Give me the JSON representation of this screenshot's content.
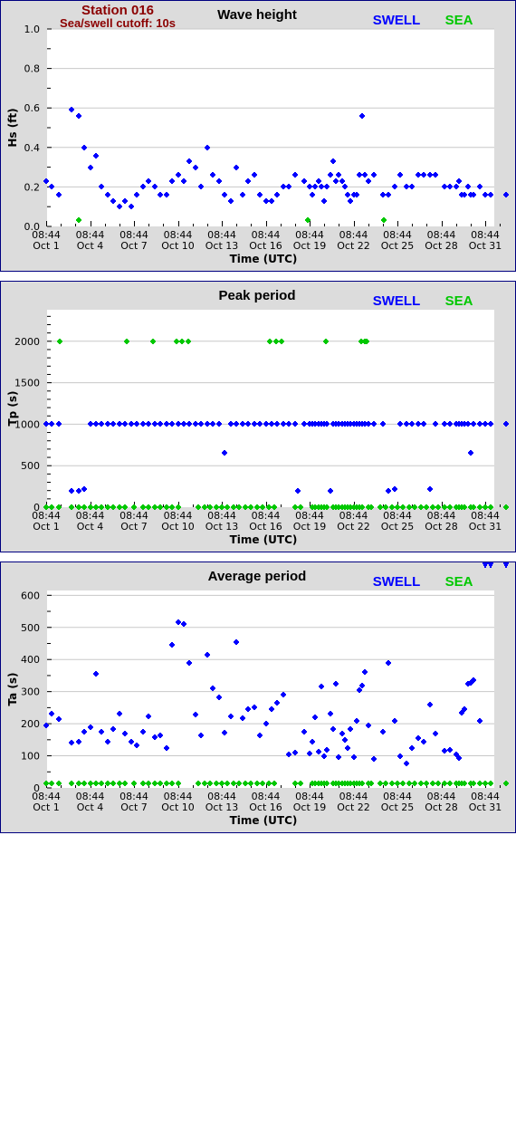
{
  "header": {
    "station": "Station 016",
    "cutoff": "Sea/swell cutoff: 10s"
  },
  "legend": {
    "swell_label": "SWELL",
    "sea_label": "SEA",
    "swell_color": "#0000ff",
    "sea_color": "#00c800"
  },
  "x_axis": {
    "label": "Time (UTC)",
    "ticks": [
      {
        "day": 0,
        "time": "08:44",
        "date": "Oct 1"
      },
      {
        "day": 3,
        "time": "08:44",
        "date": "Oct 4"
      },
      {
        "day": 6,
        "time": "08:44",
        "date": "Oct 7"
      },
      {
        "day": 9,
        "time": "08:44",
        "date": "Oct 10"
      },
      {
        "day": 12,
        "time": "08:44",
        "date": "Oct 13"
      },
      {
        "day": 15,
        "time": "08:44",
        "date": "Oct 16"
      },
      {
        "day": 18,
        "time": "08:44",
        "date": "Oct 19"
      },
      {
        "day": 21,
        "time": "08:44",
        "date": "Oct 22"
      },
      {
        "day": 24,
        "time": "08:44",
        "date": "Oct 25"
      },
      {
        "day": 27,
        "time": "08:44",
        "date": "Oct 28"
      },
      {
        "day": 30,
        "time": "08:44",
        "date": "Oct 31"
      }
    ],
    "range_days": [
      0,
      31.6
    ]
  },
  "chart_data": [
    {
      "type": "scatter",
      "title": "Wave height",
      "xlabel": "Time (UTC)",
      "ylabel": "Hs (ft)",
      "ylim": [
        0,
        1.0
      ],
      "yticks": [
        0.0,
        0.2,
        0.4,
        0.6,
        0.8,
        1.0
      ],
      "ytick_labels": [
        "0.0",
        "0.2",
        "0.4",
        "0.6",
        "0.8",
        "1.0"
      ],
      "yminor": [
        0.1,
        0.3,
        0.5,
        0.7,
        0.9
      ],
      "grid": true,
      "series": [
        {
          "name": "SWELL",
          "x": [
            0,
            0.4,
            0.85,
            1.75,
            2.2,
            2.6,
            3.0,
            3.4,
            3.8,
            4.2,
            4.6,
            5.0,
            5.4,
            5.8,
            6.2,
            6.6,
            7.0,
            7.4,
            7.8,
            8.2,
            8.6,
            9.0,
            9.4,
            9.8,
            10.2,
            10.6,
            11.0,
            11.4,
            11.8,
            12.2,
            12.6,
            13.0,
            13.4,
            13.8,
            14.2,
            14.6,
            15.0,
            15.4,
            15.8,
            16.2,
            16.6,
            17.0,
            17.6,
            18.0,
            18.2,
            18.4,
            18.6,
            18.8,
            19.0,
            19.2,
            19.4,
            19.6,
            19.8,
            20.0,
            20.2,
            20.4,
            20.6,
            20.8,
            21.0,
            21.2,
            21.4,
            21.6,
            21.8,
            22.0,
            22.4,
            23.0,
            23.4,
            23.8,
            24.2,
            24.6,
            25.0,
            25.4,
            25.8,
            26.2,
            26.6,
            27.2,
            27.6,
            28.0,
            28.2,
            28.4,
            28.6,
            28.8,
            29.0,
            29.2,
            29.6,
            30.0,
            30.4,
            31.4
          ],
          "y": [
            0.23,
            0.2,
            0.16,
            0.59,
            0.56,
            0.4,
            0.3,
            0.36,
            0.2,
            0.16,
            0.13,
            0.1,
            0.13,
            0.1,
            0.16,
            0.2,
            0.23,
            0.2,
            0.16,
            0.16,
            0.23,
            0.26,
            0.23,
            0.33,
            0.3,
            0.2,
            0.4,
            0.26,
            0.23,
            0.16,
            0.13,
            0.3,
            0.16,
            0.23,
            0.26,
            0.16,
            0.13,
            0.13,
            0.16,
            0.2,
            0.2,
            0.26,
            0.23,
            0.2,
            0.16,
            0.2,
            0.23,
            0.2,
            0.13,
            0.2,
            0.26,
            0.33,
            0.23,
            0.26,
            0.23,
            0.2,
            0.16,
            0.13,
            0.16,
            0.16,
            0.26,
            0.56,
            0.26,
            0.23,
            0.26,
            0.16,
            0.16,
            0.2,
            0.26,
            0.2,
            0.2,
            0.26,
            0.26,
            0.26,
            0.26,
            0.2,
            0.2,
            0.2,
            0.23,
            0.16,
            0.16,
            0.2,
            0.16,
            0.16,
            0.2,
            0.16,
            0.16,
            0.16
          ]
        },
        {
          "name": "SEA",
          "x": [
            2.2,
            17.9,
            23.1
          ],
          "y": [
            0.03,
            0.03,
            0.03
          ]
        }
      ]
    },
    {
      "type": "scatter",
      "title": "Peak period",
      "xlabel": "Time (UTC)",
      "ylabel": "Tp (s)",
      "ylim": [
        0,
        2380
      ],
      "yticks": [
        0,
        500,
        1000,
        1500,
        2000
      ],
      "ytick_labels": [
        "0",
        "500",
        "1000",
        "1500",
        "2000"
      ],
      "yminor": [
        100,
        200,
        300,
        400,
        600,
        700,
        800,
        900,
        1100,
        1200,
        1300,
        1400,
        1600,
        1700,
        1800,
        1900,
        2100,
        2200,
        2300
      ],
      "grid": true,
      "series": [
        {
          "name": "SWELL",
          "x": [
            0,
            0.4,
            0.85,
            1.75,
            2.2,
            2.6,
            3.0,
            3.4,
            3.8,
            4.2,
            4.6,
            5.0,
            5.4,
            5.8,
            6.2,
            6.6,
            7.0,
            7.4,
            7.8,
            8.2,
            8.6,
            9.0,
            9.4,
            9.8,
            10.2,
            10.6,
            11.0,
            11.4,
            11.8,
            12.2,
            12.6,
            13.0,
            13.4,
            13.8,
            14.2,
            14.6,
            15.0,
            15.4,
            15.8,
            16.2,
            16.6,
            17.0,
            17.2,
            17.6,
            18.0,
            18.2,
            18.4,
            18.6,
            18.8,
            19.0,
            19.2,
            19.4,
            19.6,
            19.8,
            20.0,
            20.2,
            20.4,
            20.6,
            20.8,
            21.0,
            21.2,
            21.4,
            21.6,
            21.8,
            22.0,
            22.4,
            23.0,
            23.4,
            23.8,
            24.2,
            24.6,
            25.0,
            25.4,
            25.8,
            26.2,
            26.6,
            27.2,
            27.6,
            28.0,
            28.2,
            28.4,
            28.6,
            28.8,
            29.0,
            29.2,
            29.6,
            30.0,
            30.4,
            31.4
          ],
          "y": [
            1000,
            1000,
            1000,
            200,
            200,
            220,
            1000,
            1000,
            1000,
            1000,
            1000,
            1000,
            1000,
            1000,
            1000,
            1000,
            1000,
            1000,
            1000,
            1000,
            1000,
            1000,
            1000,
            1000,
            1000,
            1000,
            1000,
            1000,
            1000,
            660,
            1000,
            1000,
            1000,
            1000,
            1000,
            1000,
            1000,
            1000,
            1000,
            1000,
            1000,
            1000,
            200,
            1000,
            1000,
            1000,
            1000,
            1000,
            1000,
            1000,
            1000,
            200,
            1000,
            1000,
            1000,
            1000,
            1000,
            1000,
            1000,
            1000,
            1000,
            1000,
            1000,
            1000,
            1000,
            1000,
            1000,
            200,
            220,
            1000,
            1000,
            1000,
            1000,
            1000,
            220,
            1000,
            1000,
            1000,
            1000,
            1000,
            1000,
            1000,
            1000,
            660,
            1000,
            1000,
            1000,
            1000,
            1000
          ]
        },
        {
          "name": "SEA",
          "x": [
            0,
            0.4,
            0.85,
            1.75,
            2.2,
            2.6,
            3.0,
            3.4,
            3.8,
            4.2,
            4.6,
            5.0,
            5.4,
            6.0,
            6.6,
            7.0,
            7.4,
            7.8,
            8.2,
            8.6,
            9.0,
            10.4,
            10.8,
            11.2,
            11.6,
            12.0,
            12.4,
            12.8,
            13.2,
            13.6,
            14.0,
            14.4,
            14.8,
            15.2,
            15.6,
            17.0,
            17.4,
            18.2,
            18.4,
            18.6,
            18.8,
            19.0,
            19.2,
            19.6,
            19.8,
            20.0,
            20.2,
            20.4,
            20.6,
            20.8,
            21.0,
            21.2,
            21.4,
            21.6,
            22.0,
            22.2,
            22.8,
            23.2,
            23.6,
            24.0,
            24.4,
            24.8,
            25.2,
            25.6,
            26.0,
            26.4,
            26.8,
            27.2,
            27.6,
            28.0,
            28.2,
            28.4,
            28.6,
            29.0,
            29.2,
            29.6,
            30.0,
            30.4,
            31.4,
            0.9,
            7.3,
            5.5,
            8.9,
            9.3,
            9.7,
            15.3,
            15.7,
            16.1,
            19.1,
            21.5,
            21.8,
            21.9
          ],
          "y": [
            0,
            0,
            0,
            0,
            0,
            0,
            0,
            0,
            0,
            0,
            0,
            0,
            0,
            0,
            0,
            0,
            0,
            0,
            0,
            0,
            0,
            0,
            0,
            0,
            0,
            0,
            0,
            0,
            0,
            0,
            0,
            0,
            0,
            0,
            0,
            0,
            0,
            0,
            0,
            0,
            0,
            0,
            0,
            0,
            0,
            0,
            0,
            0,
            0,
            0,
            0,
            0,
            0,
            0,
            0,
            0,
            0,
            0,
            0,
            0,
            0,
            0,
            0,
            0,
            0,
            0,
            0,
            0,
            0,
            0,
            0,
            0,
            0,
            0,
            0,
            0,
            0,
            0,
            0,
            2000,
            2000,
            2000,
            2000,
            2000,
            2000,
            2000,
            2000,
            2000,
            2000,
            2000,
            2000,
            2000
          ]
        }
      ]
    },
    {
      "type": "scatter",
      "title": "Average period",
      "xlabel": "Time (UTC)",
      "ylabel": "Ta (s)",
      "ylim": [
        0,
        615
      ],
      "yticks": [
        0,
        100,
        200,
        300,
        400,
        500,
        600
      ],
      "ytick_labels": [
        "0",
        "100",
        "200",
        "300",
        "400",
        "500",
        "600"
      ],
      "yminor": [
        50,
        150,
        250,
        350,
        450,
        550
      ],
      "grid": true,
      "series": [
        {
          "name": "SWELL",
          "x": [
            0,
            0.4,
            0.85,
            1.75,
            2.2,
            2.6,
            3.0,
            3.4,
            3.8,
            4.2,
            4.6,
            5.0,
            5.4,
            5.8,
            6.2,
            6.6,
            7.0,
            7.4,
            7.8,
            8.2,
            8.6,
            9.0,
            9.4,
            9.8,
            10.2,
            10.6,
            11.0,
            11.4,
            11.8,
            12.2,
            12.6,
            13.0,
            13.4,
            13.8,
            14.2,
            14.6,
            15.0,
            15.4,
            15.8,
            16.2,
            16.6,
            17.0,
            17.6,
            18.0,
            18.2,
            18.4,
            18.6,
            18.8,
            19.0,
            19.2,
            19.4,
            19.6,
            19.8,
            20.0,
            20.2,
            20.4,
            20.6,
            20.8,
            21.0,
            21.2,
            21.4,
            21.6,
            21.8,
            22.0,
            22.4,
            23.0,
            23.4,
            23.8,
            24.2,
            24.6,
            25.0,
            25.4,
            25.8,
            26.2,
            26.6,
            27.2,
            27.6,
            28.0,
            28.2,
            28.4,
            28.6,
            28.8,
            29.0,
            29.2,
            29.6,
            30.0,
            30.4,
            31.4
          ],
          "y": [
            195,
            230,
            215,
            140,
            145,
            175,
            190,
            355,
            175,
            145,
            183,
            230,
            168,
            145,
            132,
            175,
            222,
            158,
            163,
            125,
            445,
            515,
            510,
            388,
            228,
            163,
            415,
            310,
            283,
            172,
            222,
            453,
            218,
            245,
            250,
            163,
            200,
            245,
            265,
            290,
            105,
            110,
            175,
            108,
            143,
            220,
            113,
            315,
            98,
            118,
            230,
            183,
            325,
            95,
            170,
            150,
            125,
            183,
            95,
            208,
            305,
            320,
            360,
            195,
            90,
            175,
            390,
            208,
            100,
            75,
            125,
            155,
            145,
            260,
            170,
            115,
            118,
            105,
            93,
            235,
            245,
            325,
            328,
            335,
            208
          ]
        },
        {
          "name": "SEA",
          "x": [
            0,
            0.4,
            0.85,
            1.75,
            2.2,
            2.6,
            3.0,
            3.4,
            3.8,
            4.2,
            4.6,
            5.0,
            5.4,
            6.0,
            6.6,
            7.0,
            7.4,
            7.8,
            8.2,
            8.6,
            9.0,
            10.4,
            10.8,
            11.2,
            11.6,
            12.0,
            12.4,
            12.8,
            13.2,
            13.6,
            14.0,
            14.4,
            14.8,
            15.2,
            15.6,
            17.0,
            17.4,
            18.2,
            18.4,
            18.6,
            18.8,
            19.0,
            19.2,
            19.6,
            19.8,
            20.0,
            20.2,
            20.4,
            20.6,
            20.8,
            21.0,
            21.2,
            21.4,
            21.6,
            22.0,
            22.2,
            22.8,
            23.2,
            23.6,
            24.0,
            24.4,
            24.8,
            25.2,
            25.6,
            26.0,
            26.4,
            26.8,
            27.2,
            27.6,
            28.0,
            28.2,
            28.4,
            28.6,
            29.0,
            29.2,
            29.6,
            30.0,
            30.4,
            31.4
          ],
          "y": [
            15,
            15,
            15,
            15,
            15,
            15,
            15,
            15,
            15,
            15,
            15,
            15,
            15,
            15,
            15,
            15,
            15,
            15,
            15,
            15,
            15,
            15,
            15,
            15,
            15,
            15,
            15,
            15,
            15,
            15,
            15,
            15,
            15,
            15,
            15,
            15,
            15,
            15,
            15,
            15,
            15,
            15,
            15,
            15,
            15,
            15,
            15,
            15,
            15,
            15,
            15,
            15,
            15,
            15,
            15,
            15,
            15,
            15,
            15,
            15,
            15,
            15,
            15,
            15,
            15,
            15,
            15,
            15,
            15,
            15,
            15,
            15,
            15,
            15,
            15,
            15,
            15,
            15,
            15
          ]
        }
      ]
    }
  ]
}
